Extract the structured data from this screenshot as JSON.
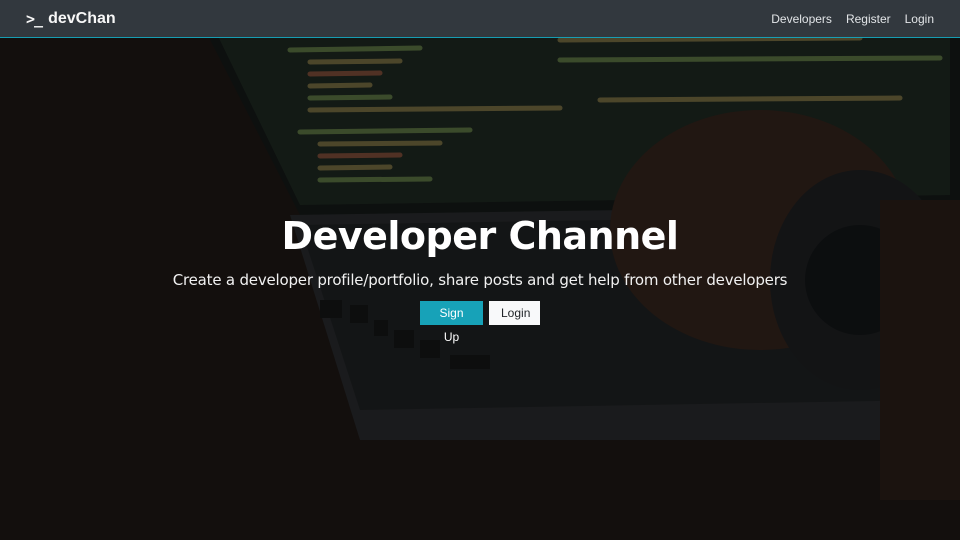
{
  "navbar": {
    "brand_icon": ">_",
    "brand_name": "devChan",
    "links": [
      "Developers",
      "Register",
      "Login"
    ]
  },
  "hero": {
    "title": "Developer Channel",
    "subtitle": "Create a developer profile/portfolio, share posts and get help from other developers",
    "signup_label": "Sign Up",
    "login_label": "Login"
  },
  "colors": {
    "navbar_bg": "#343a40",
    "accent": "#17a2b8",
    "light_button": "#f8f9fa"
  },
  "icons": {
    "brand": "terminal-prompt-icon"
  }
}
